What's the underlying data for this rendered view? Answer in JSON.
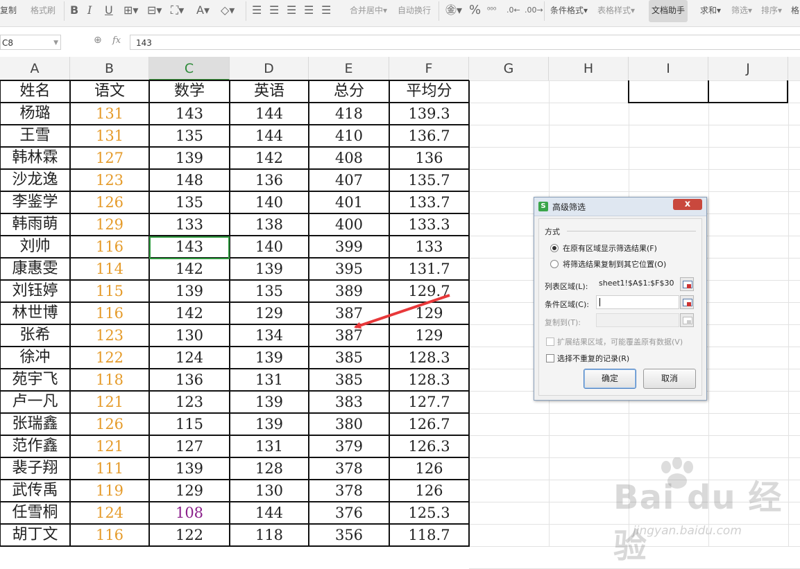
{
  "toolbar": {
    "copy": "复制",
    "format_painter": "格式刷",
    "merge_center": "合并居中",
    "auto_wrap": "自动换行",
    "percent": "%",
    "conditional_format": "条件格式",
    "table_style": "表格样式",
    "doc_assistant": "文档助手",
    "sum": "求和",
    "filter": "筛选",
    "sort": "排序",
    "format": "格"
  },
  "formula_bar": {
    "name_box": "C8",
    "fx_label": "fx",
    "value": "143"
  },
  "columns": [
    "A",
    "B",
    "C",
    "D",
    "E",
    "F",
    "G",
    "H",
    "I",
    "J"
  ],
  "selected_column": "C",
  "table": {
    "headers": [
      "姓名",
      "语文",
      "数学",
      "英语",
      "总分",
      "平均分"
    ],
    "rows": [
      [
        "杨璐",
        "131",
        "143",
        "144",
        "418",
        "139.3"
      ],
      [
        "王雪",
        "131",
        "135",
        "144",
        "410",
        "136.7"
      ],
      [
        "韩林霖",
        "127",
        "139",
        "142",
        "408",
        "136"
      ],
      [
        "沙龙逸",
        "123",
        "148",
        "136",
        "407",
        "135.7"
      ],
      [
        "李鉴学",
        "126",
        "135",
        "140",
        "401",
        "133.7"
      ],
      [
        "韩雨萌",
        "129",
        "133",
        "138",
        "400",
        "133.3"
      ],
      [
        "刘帅",
        "116",
        "143",
        "140",
        "399",
        "133"
      ],
      [
        "康惠雯",
        "114",
        "142",
        "139",
        "395",
        "131.7"
      ],
      [
        "刘钰婷",
        "115",
        "139",
        "135",
        "389",
        "129.7"
      ],
      [
        "林世博",
        "116",
        "142",
        "129",
        "387",
        "129"
      ],
      [
        "张希",
        "123",
        "130",
        "134",
        "387",
        "129"
      ],
      [
        "徐冲",
        "122",
        "124",
        "139",
        "385",
        "128.3"
      ],
      [
        "苑宇飞",
        "118",
        "136",
        "131",
        "385",
        "128.3"
      ],
      [
        "卢一凡",
        "121",
        "123",
        "139",
        "383",
        "127.7"
      ],
      [
        "张瑞鑫",
        "126",
        "115",
        "139",
        "380",
        "126.7"
      ],
      [
        "范作鑫",
        "121",
        "127",
        "131",
        "379",
        "126.3"
      ],
      [
        "裴子翔",
        "111",
        "139",
        "128",
        "378",
        "126"
      ],
      [
        "武传禹",
        "119",
        "129",
        "130",
        "378",
        "126"
      ],
      [
        "任雪桐",
        "124",
        "108",
        "144",
        "376",
        "125.3"
      ],
      [
        "胡丁文",
        "116",
        "122",
        "118",
        "356",
        "118.7"
      ]
    ]
  },
  "colors": {
    "chinese_score": "#e59b2a",
    "low_math": "#8a1f8a",
    "selection": "#2f9a3f",
    "arrow": "#e8383a"
  },
  "dialog": {
    "title": "高级筛选",
    "icon_letter": "S",
    "close": "x",
    "section": "方式",
    "option_in_place": "在原有区域显示筛选结果(F)",
    "option_copy": "将筛选结果复制到其它位置(O)",
    "list_range_label": "列表区域(L):",
    "list_range_value": "sheet1!$A$1:$F$30",
    "criteria_label": "条件区域(C):",
    "criteria_value": "",
    "copy_to_label": "复制到(T):",
    "expand_label": "扩展结果区域，可能覆盖原有数据(V)",
    "unique_label": "选择不重复的记录(R)",
    "ok": "确定",
    "cancel": "取消"
  },
  "watermark": {
    "logo": "Bai du 经验",
    "url": "jingyan.baidu.com"
  }
}
